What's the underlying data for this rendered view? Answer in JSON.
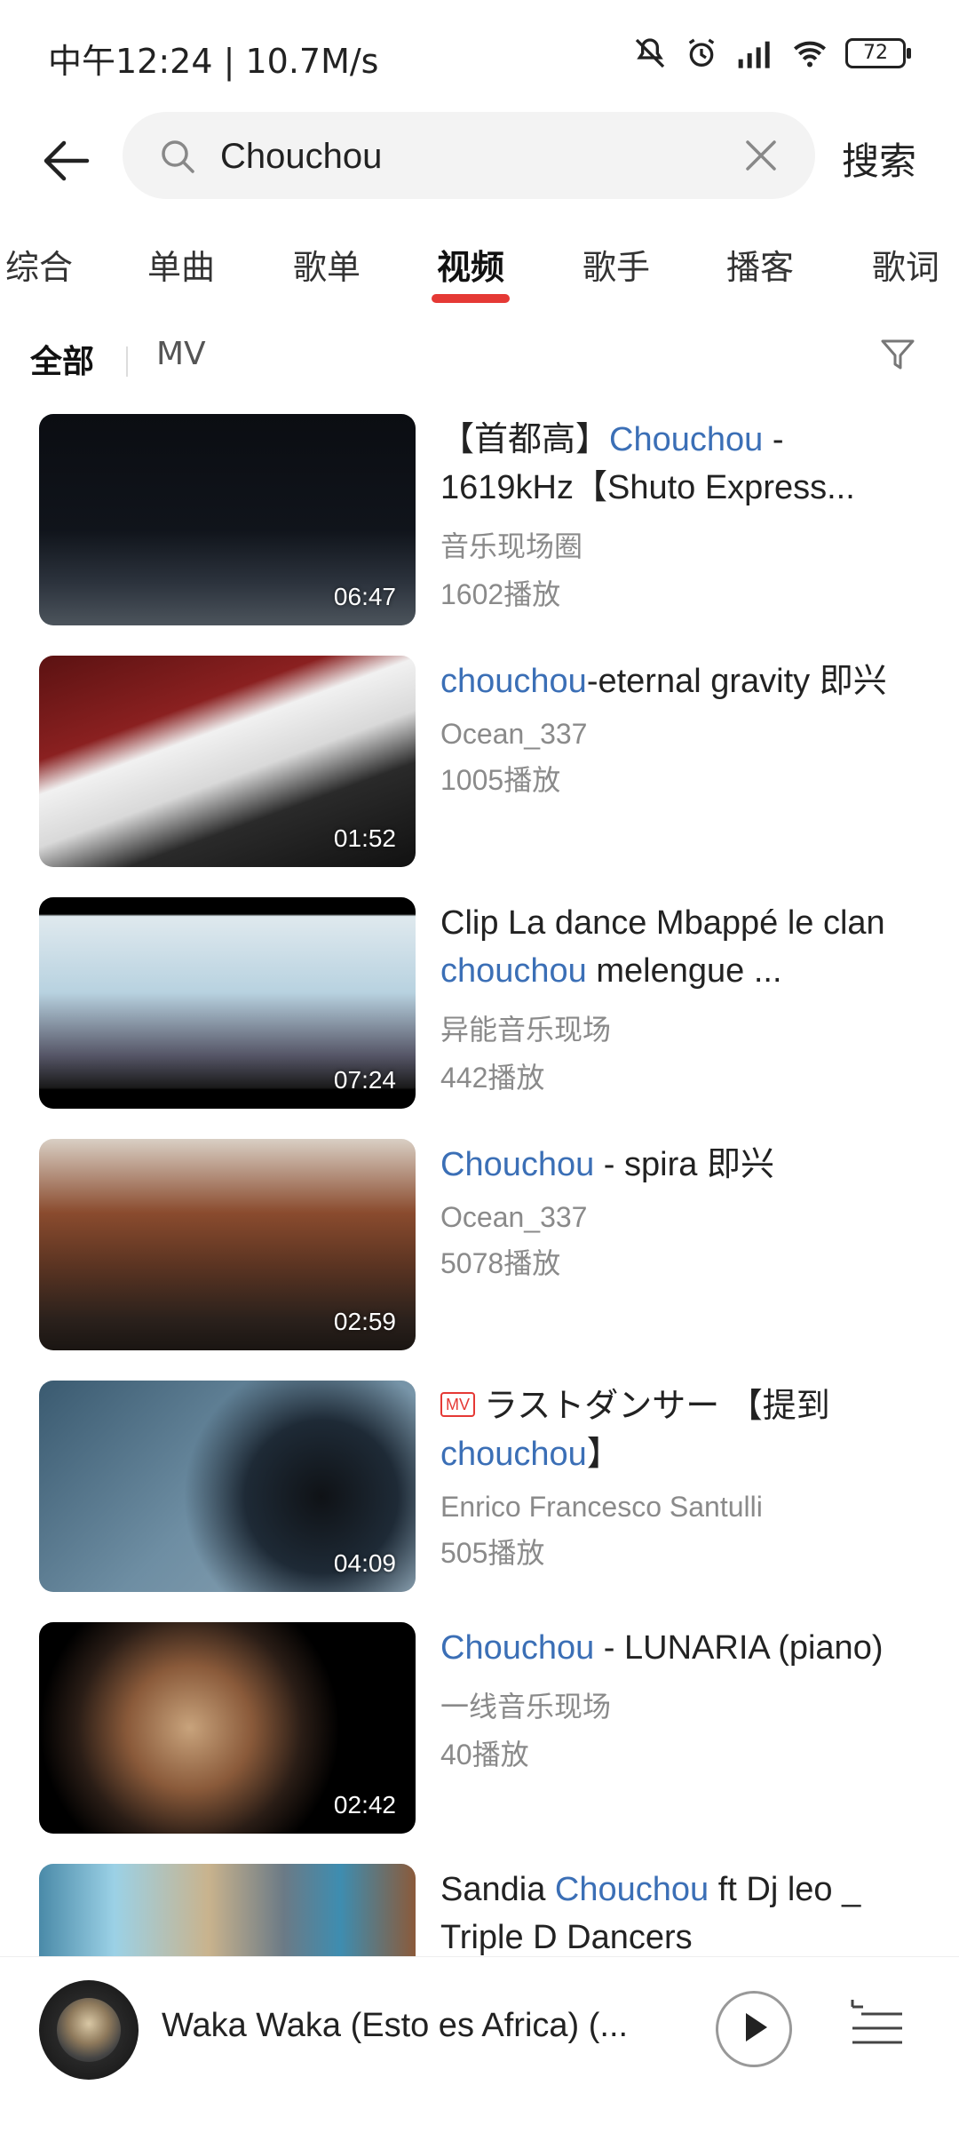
{
  "status": {
    "time": "中午12:24 | 10.7M/s",
    "battery": "72"
  },
  "search": {
    "query": "Chouchou",
    "button_label": "搜索"
  },
  "tabs": [
    {
      "label": "综合"
    },
    {
      "label": "单曲"
    },
    {
      "label": "歌单"
    },
    {
      "label": "视频",
      "active": true
    },
    {
      "label": "歌手"
    },
    {
      "label": "播客"
    },
    {
      "label": "歌词"
    }
  ],
  "subfilter": {
    "all": "全部",
    "mv": "MV"
  },
  "videos": [
    {
      "pre": "【首都高】",
      "hl": "Chouchou",
      "post": " - 1619kHz【Shuto Express...",
      "author": "音乐现场圈",
      "plays": "1602播放",
      "duration": "06:47"
    },
    {
      "pre": "",
      "hl": "chouchou",
      "post": "-eternal gravity 即兴",
      "author": "Ocean_337",
      "plays": "1005播放",
      "duration": "01:52"
    },
    {
      "pre": "Clip La dance Mbappé le clan ",
      "hl": "chouchou",
      "post": " melengue ...",
      "author": "异能音乐现场",
      "plays": "442播放",
      "duration": "07:24"
    },
    {
      "pre": "",
      "hl": "Chouchou",
      "post": " - spira 即兴",
      "author": "Ocean_337",
      "plays": "5078播放",
      "duration": "02:59"
    },
    {
      "badge": "MV",
      "pre": "ラストダンサー 【提到",
      "hl": "chouchou",
      "post": "】",
      "author": "Enrico Francesco Santulli",
      "plays": "505播放",
      "duration": "04:09"
    },
    {
      "pre": "",
      "hl": "Chouchou",
      "post": " - LUNARIA (piano)",
      "author": "一线音乐现场",
      "plays": "40播放",
      "duration": "02:42"
    },
    {
      "pre": "Sandia ",
      "hl": "Chouchou",
      "post": " ft Dj leo _ Triple D Dancers",
      "author": "",
      "plays": "",
      "duration": ""
    }
  ],
  "player": {
    "song": "Waka Waka (Esto es Africa) (..."
  }
}
